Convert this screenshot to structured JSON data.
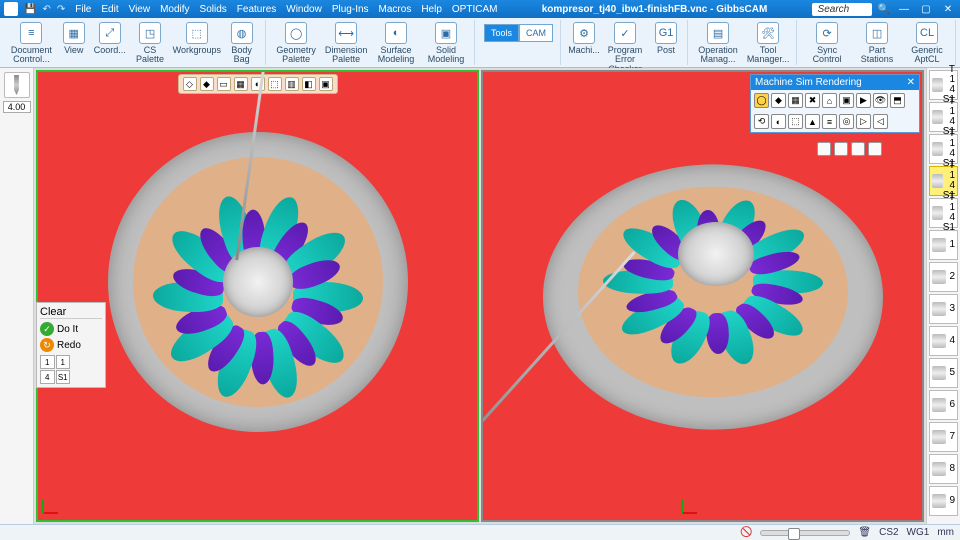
{
  "title": "kompresor_tj40_ibw1-finishFB.vnc - GibbsCAM",
  "menus": [
    "File",
    "Edit",
    "View",
    "Modify",
    "Solids",
    "Features",
    "Window",
    "Plug-Ins",
    "Macros",
    "Help",
    "OPTICAM"
  ],
  "search_placeholder": "Search",
  "ribbon": {
    "groups": [
      {
        "items": [
          {
            "icon": "≡",
            "label": "Document Control..."
          },
          {
            "icon": "▦",
            "label": "View"
          },
          {
            "icon": "⤢",
            "label": "Coord..."
          },
          {
            "icon": "◳",
            "label": "CS Palette"
          },
          {
            "icon": "⬚",
            "label": "Workgroups"
          },
          {
            "icon": "◍",
            "label": "Body Bag"
          }
        ]
      },
      {
        "items": [
          {
            "icon": "◯",
            "label": "Geometry Palette"
          },
          {
            "icon": "⟷",
            "label": "Dimension Palette"
          },
          {
            "icon": "◐",
            "label": "Surface Modeling"
          },
          {
            "icon": "▣",
            "label": "Solid Modeling"
          }
        ]
      },
      {
        "tabs": {
          "left": "Tools",
          "right": "CAM"
        }
      },
      {
        "items": [
          {
            "icon": "⚙",
            "label": "Machi..."
          },
          {
            "icon": "✓",
            "label": "Program Error Checker"
          },
          {
            "icon": "G1",
            "label": "Post"
          }
        ]
      },
      {
        "items": [
          {
            "icon": "▤",
            "label": "Operation Manag..."
          },
          {
            "icon": "🛠",
            "label": "Tool Manager..."
          }
        ]
      },
      {
        "items": [
          {
            "icon": "⟳",
            "label": "Sync Control"
          },
          {
            "icon": "◫",
            "label": "Part Stations"
          },
          {
            "icon": "CL",
            "label": "Generic AptCL"
          }
        ]
      }
    ]
  },
  "left": {
    "tool_value": "4.00",
    "clear": "Clear",
    "doit": "Do It",
    "redo": "Redo",
    "slots": [
      "1",
      "1",
      "4",
      "S1"
    ]
  },
  "sim_panel": {
    "title": "Machine Sim Rendering"
  },
  "right_items": [
    {
      "t": "T 1",
      "s": "4",
      "b": "S1",
      "sel": false
    },
    {
      "t": "T 1",
      "s": "4",
      "b": "S1",
      "sel": false
    },
    {
      "t": "T 1",
      "s": "4",
      "b": "S1",
      "sel": false
    },
    {
      "t": "T 1",
      "s": "4",
      "b": "S1",
      "sel": true
    },
    {
      "t": "T 1",
      "s": "4",
      "b": "S1",
      "sel": false
    },
    {
      "t": "",
      "s": "1",
      "b": "",
      "sel": false
    },
    {
      "t": "",
      "s": "2",
      "b": "",
      "sel": false
    },
    {
      "t": "",
      "s": "3",
      "b": "",
      "sel": false
    },
    {
      "t": "",
      "s": "4",
      "b": "",
      "sel": false
    },
    {
      "t": "",
      "s": "5",
      "b": "",
      "sel": false
    },
    {
      "t": "",
      "s": "6",
      "b": "",
      "sel": false
    },
    {
      "t": "",
      "s": "7",
      "b": "",
      "sel": false
    },
    {
      "t": "",
      "s": "8",
      "b": "",
      "sel": false
    },
    {
      "t": "",
      "s": "9",
      "b": "",
      "sel": false
    }
  ],
  "status": {
    "cs": "CS2",
    "wg": "WG1",
    "unit": "mm"
  }
}
